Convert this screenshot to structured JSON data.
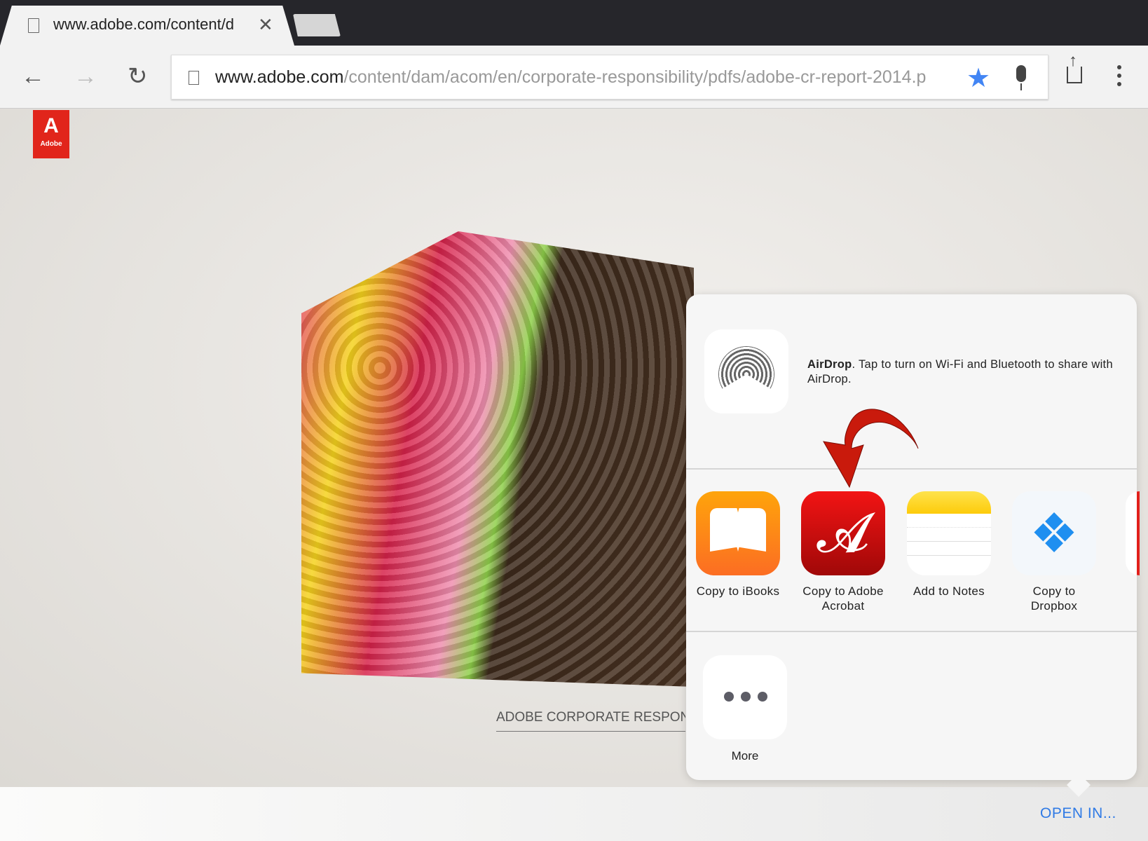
{
  "browser": {
    "tab": {
      "title": "www.adobe.com/content/d",
      "close_icon": "close-icon"
    },
    "url": {
      "host": "www.adobe.com",
      "path": "/content/dam/acom/en/corporate-responsibility/pdfs/adobe-cr-report-2014.p"
    },
    "bookmark_color": "#4285f4"
  },
  "page": {
    "logo_text": "Adobe",
    "caption": "ADOBE CORPORATE RESPONSIBILITY"
  },
  "share_sheet": {
    "airdrop": {
      "title": "AirDrop",
      "message": ". Tap to turn on Wi-Fi and Bluetooth to share with AirDrop."
    },
    "apps": [
      {
        "label": "Copy to iBooks",
        "icon": "ibooks-icon"
      },
      {
        "label": "Copy to Adobe Acrobat",
        "icon": "acrobat-icon"
      },
      {
        "label": "Add to Notes",
        "icon": "notes-icon"
      },
      {
        "label": "Copy to Dropbox",
        "icon": "dropbox-icon"
      }
    ],
    "more_label": "More"
  },
  "bottom_bar": {
    "open_in": "OPEN IN...",
    "color": "#2f7ae5"
  }
}
